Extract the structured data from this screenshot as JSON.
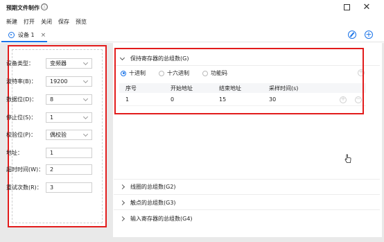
{
  "window": {
    "title": "预期文件制作",
    "info_icon": "ⓘ",
    "minimize": "",
    "close": "✕"
  },
  "menu": [
    "新建",
    "打开",
    "关闭",
    "保存",
    "预览"
  ],
  "tab": {
    "label": "设备 1",
    "close": "×"
  },
  "form": {
    "device_type": {
      "label": "设备类型：",
      "value": "变频器"
    },
    "baud_rate": {
      "label": "波特率(B)：",
      "value": "19200"
    },
    "data_bits": {
      "label": "数据位(D)：",
      "value": "8"
    },
    "stop_bits": {
      "label": "停止位(S)：",
      "value": "1"
    },
    "parity": {
      "label": "校验位(P)：",
      "value": "偶校验"
    },
    "address": {
      "label": "地址：",
      "value": "1"
    },
    "timeout": {
      "label": "超时时间(W)：",
      "value": "2"
    },
    "retries": {
      "label": "重试次数(R)：",
      "value": "3"
    }
  },
  "sections": {
    "holding": "保持寄存器的总组数(G)",
    "coils": "线圈的总组数(G2)",
    "contacts": "触点的总组数(G3)",
    "input_regs": "输入寄存器的总组数(G4)"
  },
  "radios": {
    "decimal": "十进制",
    "hex": "十六进制",
    "function_code": "功能码",
    "selected": "decimal"
  },
  "table": {
    "headers": [
      "序号",
      "开始地址",
      "结束地址",
      "采样时间(s)"
    ],
    "rows": [
      [
        "1",
        "0",
        "15",
        "30"
      ]
    ]
  },
  "colors": {
    "accent": "#1a73e8",
    "highlight": "#e21b1b"
  }
}
